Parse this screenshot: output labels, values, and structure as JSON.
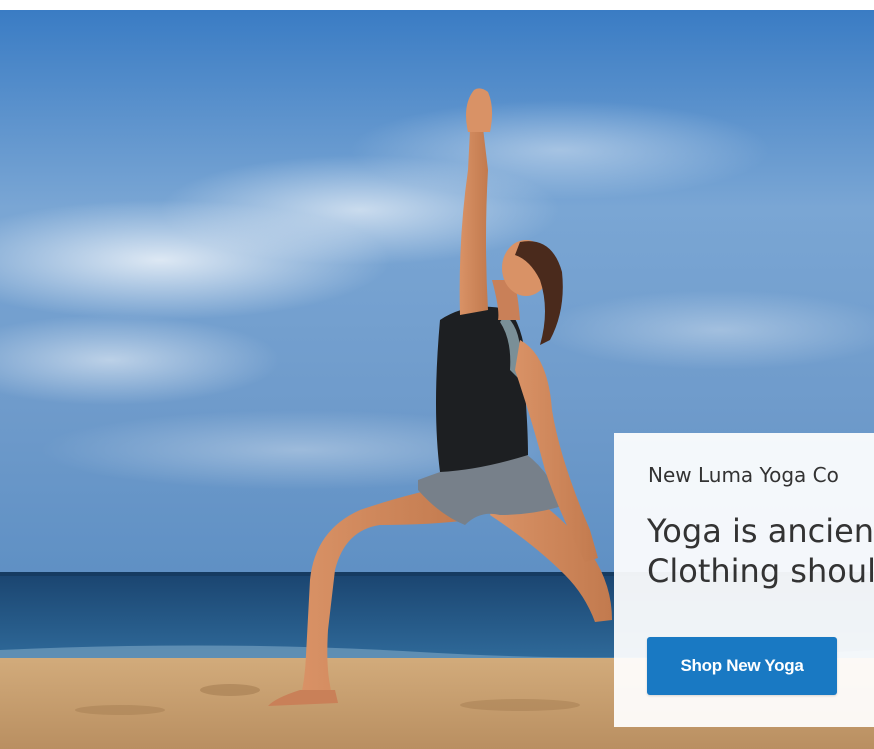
{
  "promo": {
    "subtitle": "New Luma Yoga Co",
    "headline_line1": "Yoga is ancien",
    "headline_line2": "Clothing shoul",
    "cta_label": "Shop New Yoga"
  },
  "colors": {
    "cta_background": "#1979c3",
    "cta_text": "#ffffff",
    "promo_text": "#333333",
    "sky_top": "#3d7fc6",
    "sea": "#1d4f7e",
    "sand": "#c9a272"
  }
}
